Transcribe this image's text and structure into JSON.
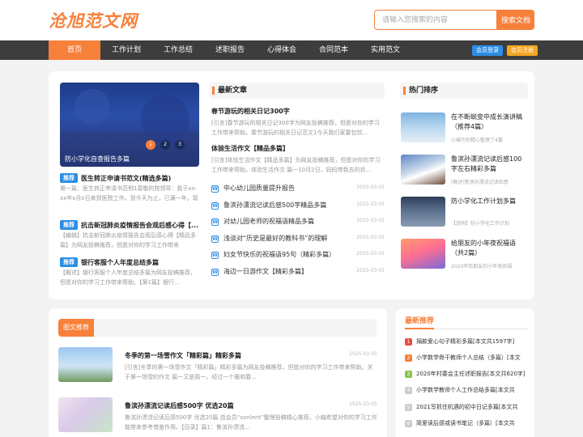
{
  "header": {
    "logo": "沧旭范文网",
    "search_placeholder": "请输入您搜索的内容",
    "search_button": "搜索文档"
  },
  "nav": {
    "items": [
      "首页",
      "工作计划",
      "工作总结",
      "述职报告",
      "心得体会",
      "合同范本",
      "实用范文"
    ],
    "active": "首页",
    "login": "会员登录",
    "register": "会员注册"
  },
  "colors": {
    "accent": "#f7803b",
    "nav_bg": "#3d3d3d",
    "tag": "#2c8ee6",
    "login": "#2c8ee6",
    "register": "#f5a623"
  },
  "slider": {
    "caption": "防小学化自查报告多篇",
    "dots": [
      "1",
      "2",
      "3"
    ]
  },
  "left_list": [
    {
      "tag": "推荐",
      "title": "医生转正申请书范文(精选多篇)",
      "desc": "第一篇：医生转正申请书范例1尊敬的院领导：我于xx-xx年x月x日来到医院工作，到今天为止，已满一年。现将"
    },
    {
      "tag": "推荐",
      "title": "抗击新冠肺炎疫情报告会观后感心得【...",
      "desc": "【编辑】抗击新冠肺炎疫情报告会观后感心得【精品多篇】为网友投稿推荐，但愿对你的学习工作带来"
    },
    {
      "tag": "推荐",
      "title": "银行客服个人年度总结多篇",
      "desc": "【概述】银行客服个人年度总结多篇为网友投稿推荐，但愿对你的学习工作带来帮助。【第1篇】银行..."
    }
  ],
  "latest": {
    "heading": "最新文章",
    "featured": [
      {
        "title": "春节游玩的相关日记300字",
        "desc": "[引言]春节游玩的相关日记300字为网友投稿推荐，但愿对你的学习工作带来帮助。春节游玩的相关日记范文1今天我们家要包饺..."
      },
      {
        "title": "体验生活作文【精品多篇】",
        "desc": "[引言]体验生活作文【精品多篇】为网友投稿推荐，但愿对你的学习工作带来帮助。体验生活作文 篇一10月2日，妈妈带我去的农..."
      }
    ],
    "items": [
      {
        "title": "中心幼儿园质量提升报告",
        "date": "2025-03-05"
      },
      {
        "title": "鲁滨孙漂流记读后感500字精品多篇",
        "date": "2025-03-05"
      },
      {
        "title": "对幼儿园老师的祝福语精品多篇",
        "date": "2025-03-05"
      },
      {
        "title": "浅谈对“历史是最好的教科书”的理解",
        "date": "2025-03-05"
      },
      {
        "title": "妇女节快乐的祝福语95句（精彩多篇）",
        "date": "2025-03-05"
      },
      {
        "title": "海边一日游作文【精彩多篇】",
        "date": "2025-03-05"
      }
    ]
  },
  "hot": {
    "heading": "热门排序",
    "items": [
      {
        "title": "在不断蜕变中成长演讲稿（推荐4篇）",
        "sub": "小编为你精心整理了4篇"
      },
      {
        "title": "鲁滨孙漂流记读后感100字左右精彩多篇",
        "sub": "[概述]鲁滨孙漂流记读后感"
      },
      {
        "title": "防小学化工作计划多篇",
        "sub": "【说明】防小学化工作计划"
      },
      {
        "title": "给朋友的小年夜祝福语（共2篇）",
        "sub": "2020年给朋友的小年夜祝福"
      }
    ]
  },
  "tuwen": {
    "tab": "图文推荐",
    "items": [
      {
        "title": "冬季的第一场雪作文「精彩篇」精彩多篇",
        "date": "2025-03-05",
        "desc": "[引言]冬季的第一场雪作文「精彩篇」精彩多篇为网友投稿推荐，但愿对你的学习工作带来帮助。关于第一场雪的作文 篇一又是周一，经过一个暖和春..."
      },
      {
        "title": "鲁滨孙漂流记读后感500字 优选20篇",
        "date": "2025-03-05",
        "desc": "鲁滨孙漂流记读后感500字 优选20篇 由会员“sonlent”整理投稿精心推荐，小编希望对你的学习工作能带来参考借鉴作用。【目录】篇1：鲁滨孙漂流..."
      }
    ]
  },
  "newest": {
    "heading": "最新推荐",
    "items": [
      {
        "num": "1",
        "title": "捐款爱心句子精彩多篇[本文共1597字]",
        "color": "#e84c3d"
      },
      {
        "num": "2",
        "title": "小学数学骨干教师个人总结（多篇）[本文",
        "color": "#f7803b"
      },
      {
        "num": "3",
        "title": "2020年村委会主任述职报告[本文共620字]",
        "color": "#8bc34a"
      },
      {
        "num": "4",
        "title": "小学数学教师个人工作总结多篇[本文共",
        "color": "#cccccc"
      },
      {
        "num": "5",
        "title": "2021写抓住机遇的初中日记多篇[本文共",
        "color": "#cccccc"
      },
      {
        "num": "6",
        "title": "简爱读后感或读书笔记（多篇）[本文共",
        "color": "#cccccc"
      }
    ]
  }
}
